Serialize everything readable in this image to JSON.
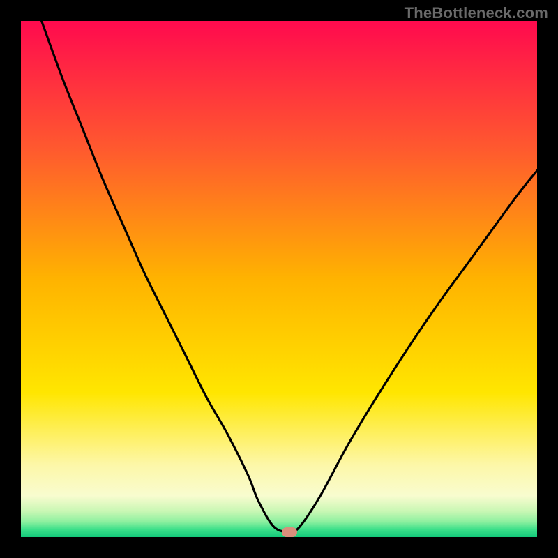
{
  "attribution": "TheBottleneck.com",
  "chart_data": {
    "type": "line",
    "title": "",
    "xlabel": "",
    "ylabel": "",
    "xlim": [
      0,
      100
    ],
    "ylim": [
      0,
      100
    ],
    "x": [
      4,
      8,
      12,
      16,
      20,
      24,
      28,
      32,
      36,
      40,
      44,
      46,
      49,
      52,
      54,
      58,
      64,
      72,
      80,
      88,
      96,
      100
    ],
    "values": [
      100,
      89,
      79,
      69,
      60,
      51,
      43,
      35,
      27,
      20,
      12,
      7,
      2,
      1,
      2,
      8,
      19,
      32,
      44,
      55,
      66,
      71
    ],
    "marker": {
      "x": 52,
      "y": 0.9
    },
    "gradient_stops": [
      {
        "pct": 0,
        "color": "#ff0a4e"
      },
      {
        "pct": 25,
        "color": "#ff5a2e"
      },
      {
        "pct": 50,
        "color": "#ffb300"
      },
      {
        "pct": 72,
        "color": "#ffe600"
      },
      {
        "pct": 86,
        "color": "#fdf7a8"
      },
      {
        "pct": 92,
        "color": "#f8fccf"
      },
      {
        "pct": 95,
        "color": "#c9f7b4"
      },
      {
        "pct": 97,
        "color": "#8ef0a0"
      },
      {
        "pct": 98.5,
        "color": "#3de08a"
      },
      {
        "pct": 100,
        "color": "#12c97a"
      }
    ]
  }
}
